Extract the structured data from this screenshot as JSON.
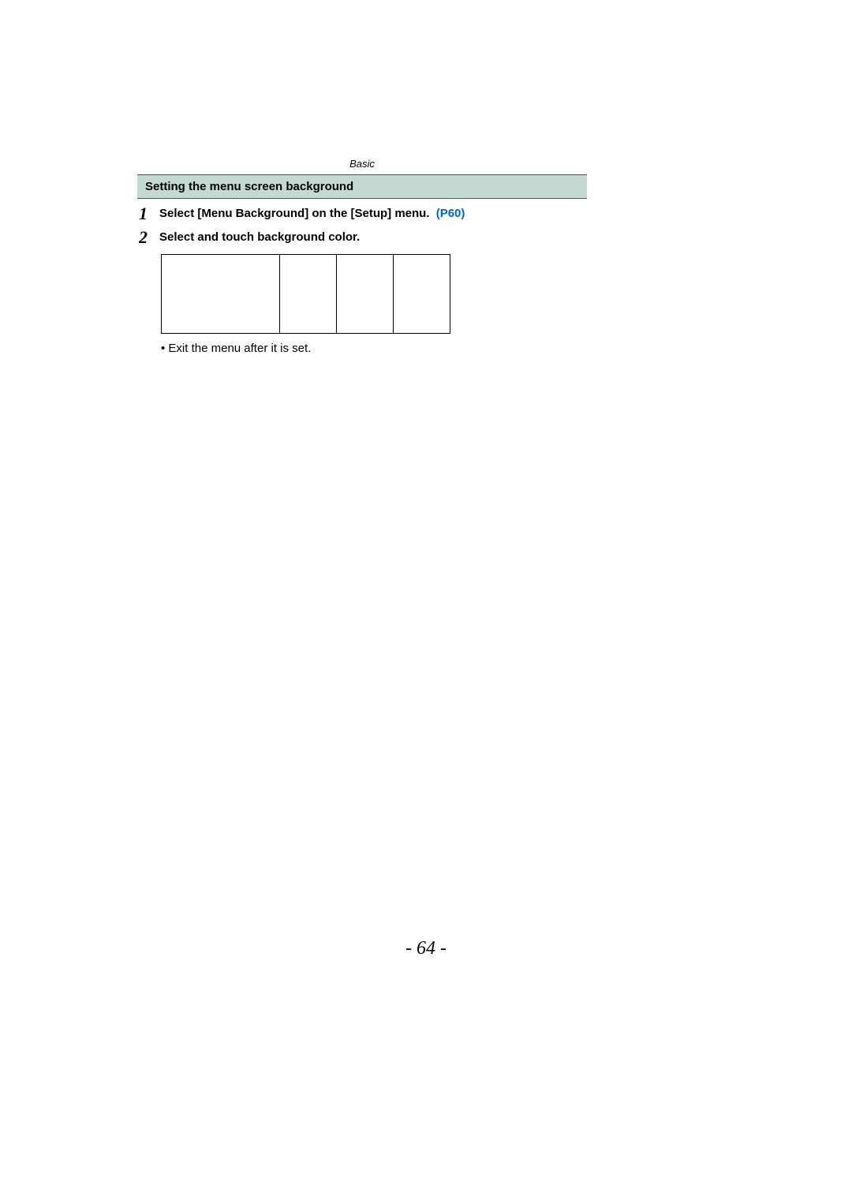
{
  "header": {
    "category": "Basic"
  },
  "section": {
    "title": "Setting the menu screen background"
  },
  "steps": [
    {
      "num": "1",
      "text": "Select [Menu Background] on the [Setup] menu.",
      "link": "(P60)"
    },
    {
      "num": "2",
      "text": "Select and touch background color.",
      "link": ""
    }
  ],
  "note": "• Exit the menu after it is set.",
  "page_number": "- 64 -"
}
